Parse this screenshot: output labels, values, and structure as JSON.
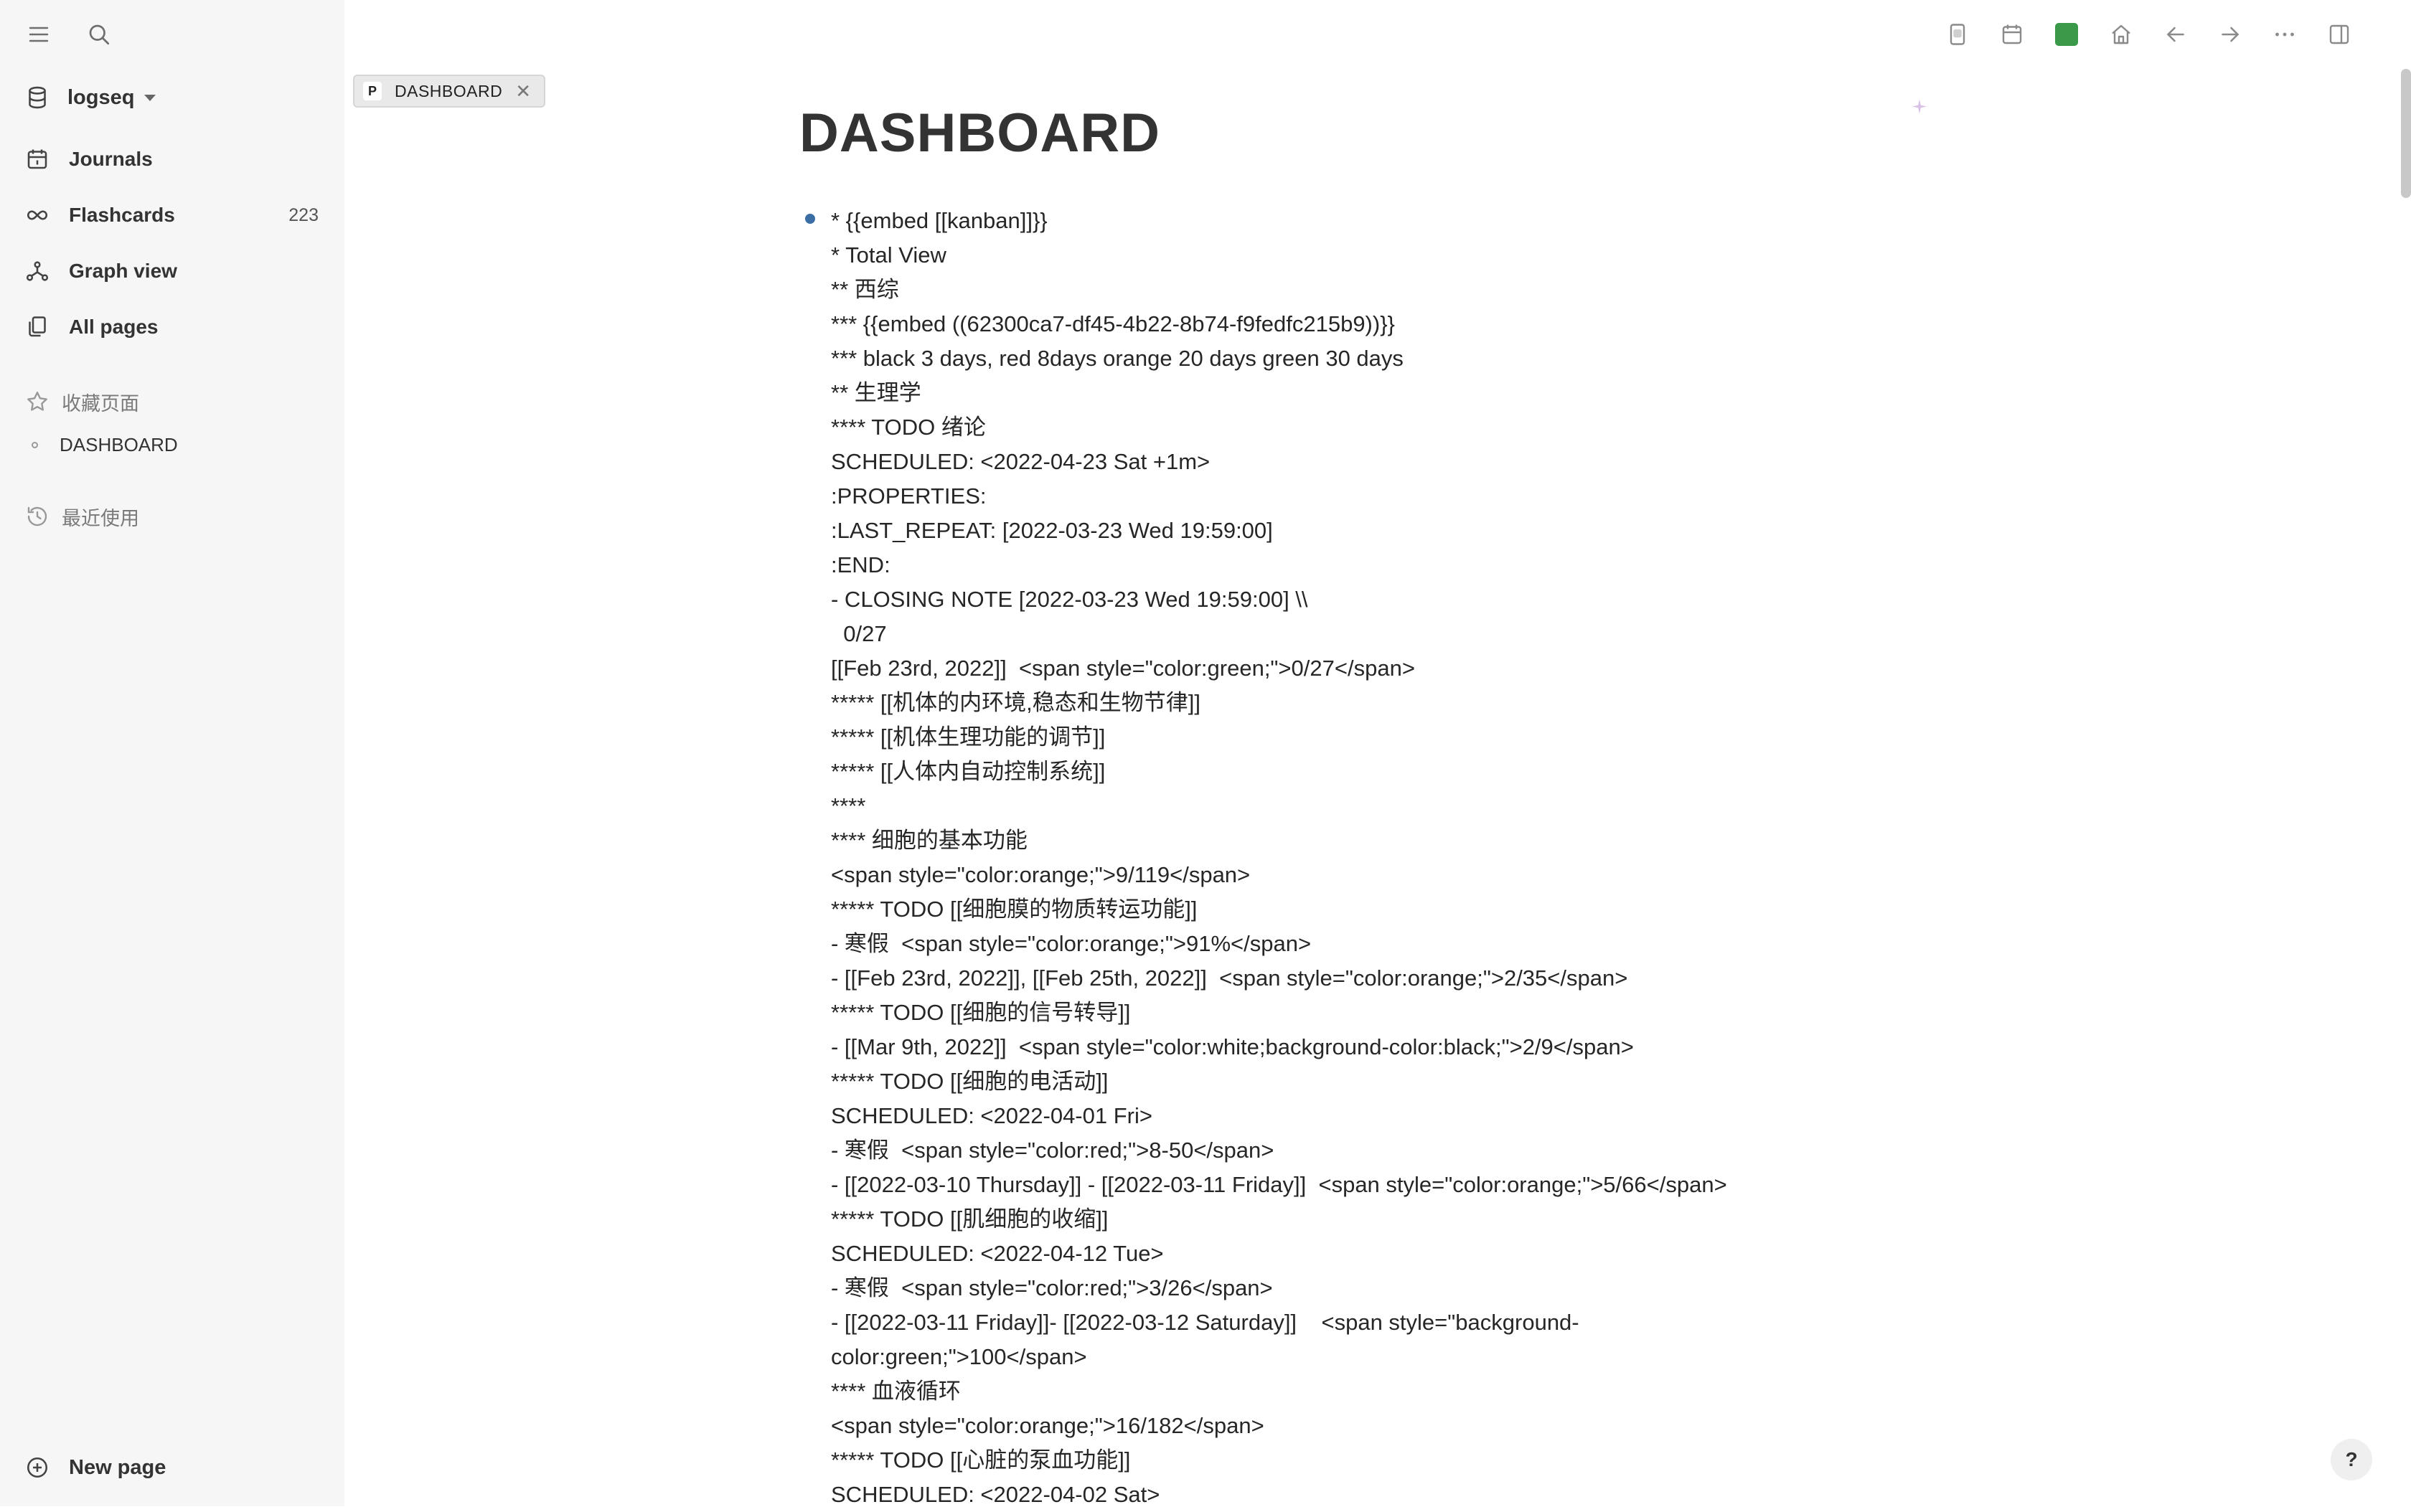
{
  "sidebar": {
    "graph_name": "logseq",
    "nav": [
      {
        "label": "Journals"
      },
      {
        "label": "Flashcards",
        "count": "223"
      },
      {
        "label": "Graph view"
      },
      {
        "label": "All pages"
      }
    ],
    "favorites_title": "收藏页面",
    "favorites": [
      "DASHBOARD"
    ],
    "recent_title": "最近使用",
    "new_page_label": "New page"
  },
  "tab": {
    "prefix": "P",
    "label": "DASHBOARD"
  },
  "page": {
    "title": "DASHBOARD",
    "lines": [
      "* {{embed [[kanban]]}}",
      "* Total View",
      "** 西综",
      "*** {{embed ((62300ca7-df45-4b22-8b74-f9fedfc215b9))}}",
      "*** black 3 days, red 8days orange 20 days green 30 days",
      "** 生理学",
      "**** TODO 绪论",
      "SCHEDULED: <2022-04-23 Sat +1m>",
      ":PROPERTIES:",
      ":LAST_REPEAT: [2022-03-23 Wed 19:59:00]",
      ":END:",
      "- CLOSING NOTE [2022-03-23 Wed 19:59:00] \\\\",
      "  0/27",
      "[[Feb 23rd, 2022]]  <span style=\"color:green;\">0/27</span>",
      "***** [[机体的内环境,稳态和生物节律]]",
      "***** [[机体生理功能的调节]]",
      "***** [[人体内自动控制系统]]",
      "****",
      "**** 细胞的基本功能",
      "<span style=\"color:orange;\">9/119</span>",
      "***** TODO [[细胞膜的物质转运功能]]",
      "- 寒假  <span style=\"color:orange;\">91%</span>",
      "- [[Feb 23rd, 2022]], [[Feb 25th, 2022]]  <span style=\"color:orange;\">2/35</span>",
      "***** TODO [[细胞的信号转导]]",
      "- [[Mar 9th, 2022]]  <span style=\"color:white;background-color:black;\">2/9</span>",
      "***** TODO [[细胞的电活动]]",
      "SCHEDULED: <2022-04-01 Fri>",
      "- 寒假  <span style=\"color:red;\">8-50</span>",
      "- [[2022-03-10 Thursday]] - [[2022-03-11 Friday]]  <span style=\"color:orange;\">5/66</span>",
      "***** TODO [[肌细胞的收缩]]",
      "SCHEDULED: <2022-04-12 Tue>",
      "- 寒假  <span style=\"color:red;\">3/26</span>",
      "- [[2022-03-11 Friday]]- [[2022-03-12 Saturday]]    <span style=\"background-",
      "color:green;\">100</span>",
      "**** 血液循环",
      "<span style=\"color:orange;\">16/182</span>",
      "***** TODO [[心脏的泵血功能]]",
      "SCHEDULED: <2022-04-02 Sat>"
    ]
  },
  "help_label": "?",
  "colors": {
    "sidebar_bg": "#f6f6f6",
    "bullet": "#3a6ea5",
    "theme_swatch": "#3b9a4a"
  }
}
